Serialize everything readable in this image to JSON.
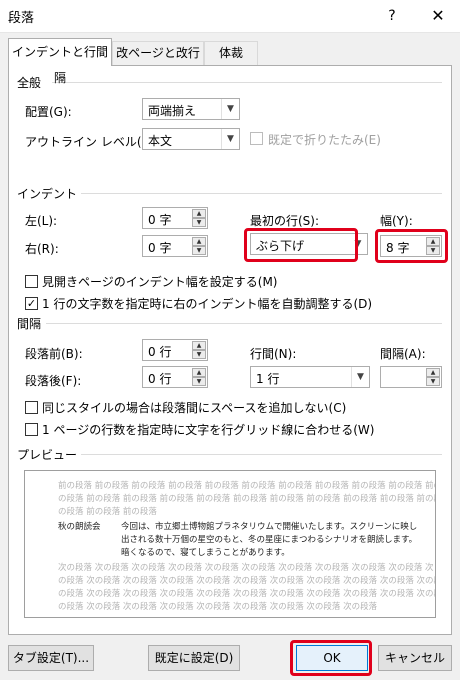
{
  "window": {
    "title": "段落",
    "help_label": "?",
    "close_label": "✕"
  },
  "tabs": [
    {
      "label": "インデントと行間隔",
      "active": true
    },
    {
      "label": "改ページと改行",
      "active": false
    },
    {
      "label": "体裁",
      "active": false
    }
  ],
  "general": {
    "section_label": "全般",
    "alignment_label": "配置(G):",
    "alignment_value": "両端揃え",
    "outline_label": "アウトライン レベル(O):",
    "outline_value": "本文",
    "collapsed_default_label": "既定で折りたたみ(E)"
  },
  "indent": {
    "section_label": "インデント",
    "left_label": "左(L):",
    "left_value": "0 字",
    "right_label": "右(R):",
    "right_value": "0 字",
    "first_line_label": "最初の行(S):",
    "first_line_value": "ぶら下げ",
    "width_label": "幅(Y):",
    "width_value": "8 字",
    "mirror_label": "見開きページのインデント幅を設定する(M)",
    "mirror_checked": false,
    "auto_adjust_label": "1 行の文字数を指定時に右のインデント幅を自動調整する(D)",
    "auto_adjust_checked": true
  },
  "spacing": {
    "section_label": "間隔",
    "before_label": "段落前(B):",
    "before_value": "0 行",
    "after_label": "段落後(F):",
    "after_value": "0 行",
    "line_spacing_label": "行間(N):",
    "line_spacing_value": "1 行",
    "at_label": "間隔(A):",
    "at_value": "",
    "dont_add_label": "同じスタイルの場合は段落間にスペースを追加しない(C)",
    "dont_add_checked": false,
    "snap_grid_label": "1 ページの行数を指定時に文字を行グリッド線に合わせる(W)",
    "snap_grid_checked": false
  },
  "preview": {
    "section_label": "プレビュー",
    "prev_lines": [
      "前の段落 前の段落 前の段落 前の段落 前の段落 前の段落 前の段落 前の段落 前の段落 前の段落 前の段落 前",
      "の段落 前の段落 前の段落 前の段落 前の段落 前の段落 前の段落 前の段落 前の段落 前の段落 前の段落 前",
      "の段落 前の段落 前の段落"
    ],
    "sample_term": "秋の朗読会",
    "sample_lines": [
      "今回は、市立郷土博物館プラネタリウムで開催いたします。スクリーンに映し",
      "出される数十万個の星空のもと、冬の星座にまつわるシナリオを朗読します。",
      "暗くなるので、寝てしまうことがあります。"
    ],
    "next_lines": [
      "次の段落 次の段落 次の段落 次の段落 次の段落 次の段落 次の段落 次の段落 次の段落 次の段落 次",
      "の段落 次の段落 次の段落 次の段落 次の段落 次の段落 次の段落 次の段落 次の段落 次の段落 次の段落 次",
      "の段落 次の段落 次の段落 次の段落 次の段落 次の段落 次の段落 次の段落 次の段落 次の段落 次の段落 次",
      "の段落 次の段落 次の段落 次の段落 次の段落 次の段落 次の段落 次の段落 次の段落"
    ]
  },
  "buttons": {
    "tabs_label": "タブ設定(T)...",
    "default_label": "既定に設定(D)",
    "ok_label": "OK",
    "cancel_label": "キャンセル"
  },
  "colors": {
    "highlight": "#e0001b",
    "dialog_bg": "#f0f0f0",
    "panel_bg": "#ffffff"
  }
}
